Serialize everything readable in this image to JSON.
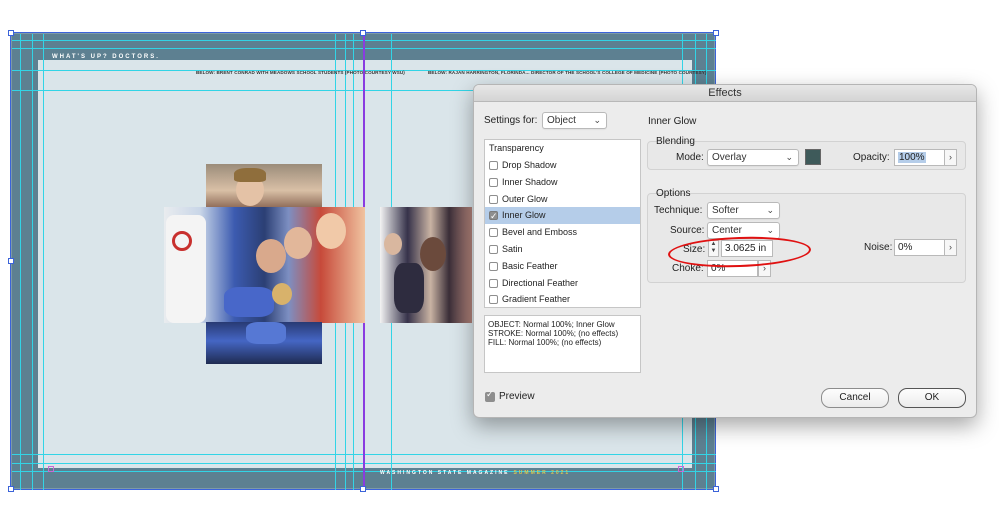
{
  "spread": {
    "running_head": "WHAT'S UP? DOCTORS.",
    "caption_left": "BELOW: BRENT CONRAD WITH MEADOWS SCHOOL STUDENTS (PHOTO COURTESY WSU)",
    "caption_right": "BELOW: RAJAN HARRINGTON, FLORINDA... DIRECTOR OF THE SCHOOL'S COLLEGE OF MEDICINE (PHOTO COURTESY)",
    "footer_text": "WASHINGTON STATE MAGAZINE",
    "footer_issue": "SUMMER 2021",
    "colors": {
      "background": "#5d8091",
      "page": "#dae5ea",
      "guide": "#32d4e6",
      "fold": "#8a3ce0"
    }
  },
  "dialog": {
    "title": "Effects",
    "settings_label": "Settings for:",
    "settings_value": "Object",
    "list_heading": "Transparency",
    "effects": [
      {
        "label": "Drop Shadow",
        "checked": false,
        "active": false
      },
      {
        "label": "Inner Shadow",
        "checked": false,
        "active": false
      },
      {
        "label": "Outer Glow",
        "checked": false,
        "active": false
      },
      {
        "label": "Inner Glow",
        "checked": true,
        "active": true
      },
      {
        "label": "Bevel and Emboss",
        "checked": false,
        "active": false
      },
      {
        "label": "Satin",
        "checked": false,
        "active": false
      },
      {
        "label": "Basic Feather",
        "checked": false,
        "active": false
      },
      {
        "label": "Directional Feather",
        "checked": false,
        "active": false
      },
      {
        "label": "Gradient Feather",
        "checked": false,
        "active": false
      }
    ],
    "summary": [
      "OBJECT: Normal 100%; Inner Glow",
      "STROKE: Normal 100%; (no effects)",
      "FILL: Normal 100%; (no effects)"
    ],
    "preview_label": "Preview",
    "panel_title": "Inner Glow",
    "blending": {
      "title": "Blending",
      "mode_label": "Mode:",
      "mode_value": "Overlay",
      "swatch_color": "#3e5a5a",
      "opacity_label": "Opacity:",
      "opacity_value": "100%"
    },
    "options": {
      "title": "Options",
      "technique_label": "Technique:",
      "technique_value": "Softer",
      "source_label": "Source:",
      "source_value": "Center",
      "size_label": "Size:",
      "size_value": "3.0625 in",
      "noise_label": "Noise:",
      "noise_value": "0%",
      "choke_label": "Choke:",
      "choke_value": "0%"
    },
    "cancel_label": "Cancel",
    "ok_label": "OK"
  },
  "icons": {
    "chevron": "chevron-down-icon",
    "arrow": "chevron-right-icon",
    "stepper": "stepper-icon",
    "check": "checkmark-icon"
  },
  "annotation_color": "#e01111"
}
